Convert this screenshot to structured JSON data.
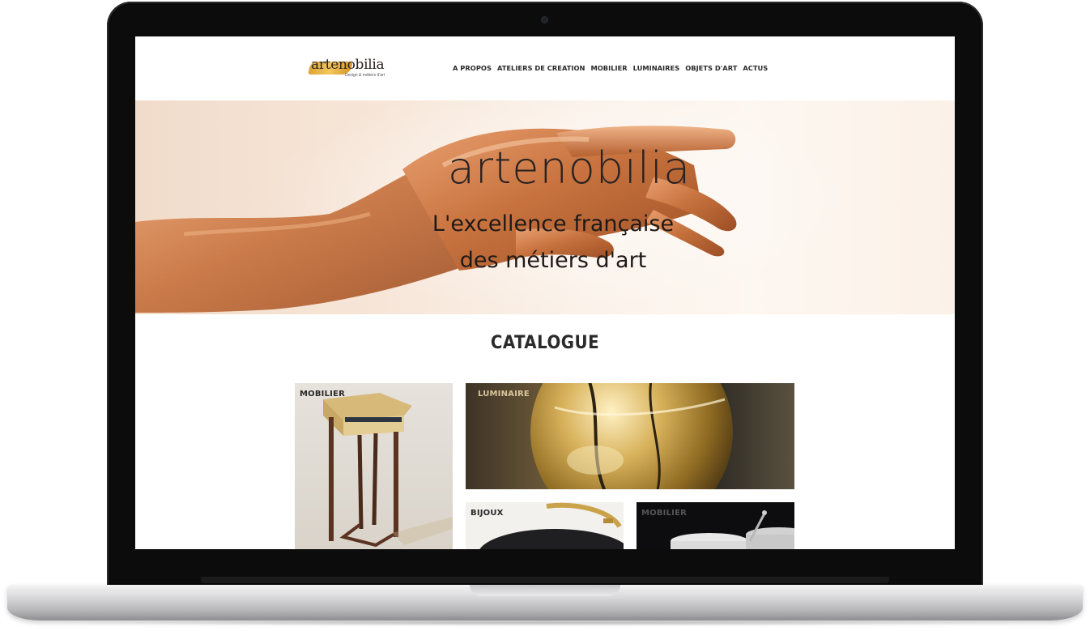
{
  "site": {
    "logo_text": "artenobilia",
    "logo_tagline": "Design & métiers d'art"
  },
  "nav": {
    "items": [
      "A PROPOS",
      "ATELIERS DE CREATION",
      "MOBILIER",
      "LUMINAIRES",
      "OBJETS D'ART",
      "ACTUS"
    ]
  },
  "hero": {
    "title": "artenobilia",
    "subtitle_line1": "L'excellence française",
    "subtitle_line2": "des métiers d'art"
  },
  "catalogue": {
    "title": "CATALOGUE",
    "tiles": [
      {
        "label": "MOBILIER",
        "label_color": "#2a2a2a"
      },
      {
        "label": "LUMINAIRE",
        "label_color": "#d9c49a"
      },
      {
        "label": "BIJOUX",
        "label_color": "#2a2a2a"
      },
      {
        "label": "MOBILIER",
        "label_color": "#555555"
      }
    ]
  },
  "colors": {
    "accent_gold": "#e3aa2e",
    "hero_copper": "#c87848",
    "text_dark": "#2a2a2a"
  }
}
